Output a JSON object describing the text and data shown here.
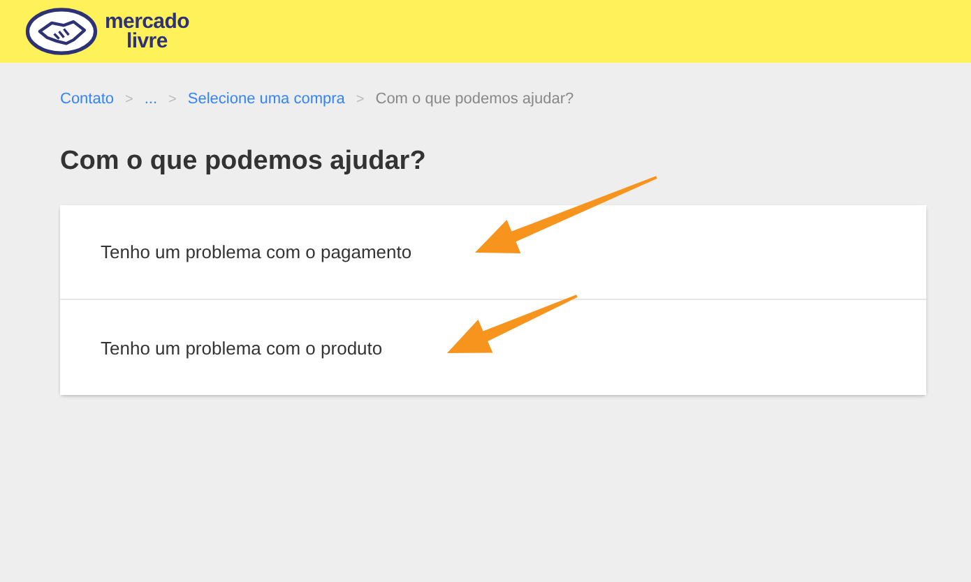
{
  "header": {
    "logo_lines": [
      "mercado",
      "livre"
    ]
  },
  "breadcrumb": {
    "separator": ">",
    "items": [
      {
        "label": "Contato",
        "kind": "link"
      },
      {
        "label": "...",
        "kind": "link"
      },
      {
        "label": "Selecione uma compra",
        "kind": "link"
      },
      {
        "label": "Com o que podemos ajudar?",
        "kind": "current"
      }
    ]
  },
  "title": "Com o que podemos ajudar?",
  "options": [
    {
      "label": "Tenho um problema com o pagamento"
    },
    {
      "label": "Tenho um problema com o produto"
    }
  ],
  "annotations": [
    {
      "kind": "arrow"
    },
    {
      "kind": "arrow"
    }
  ]
}
